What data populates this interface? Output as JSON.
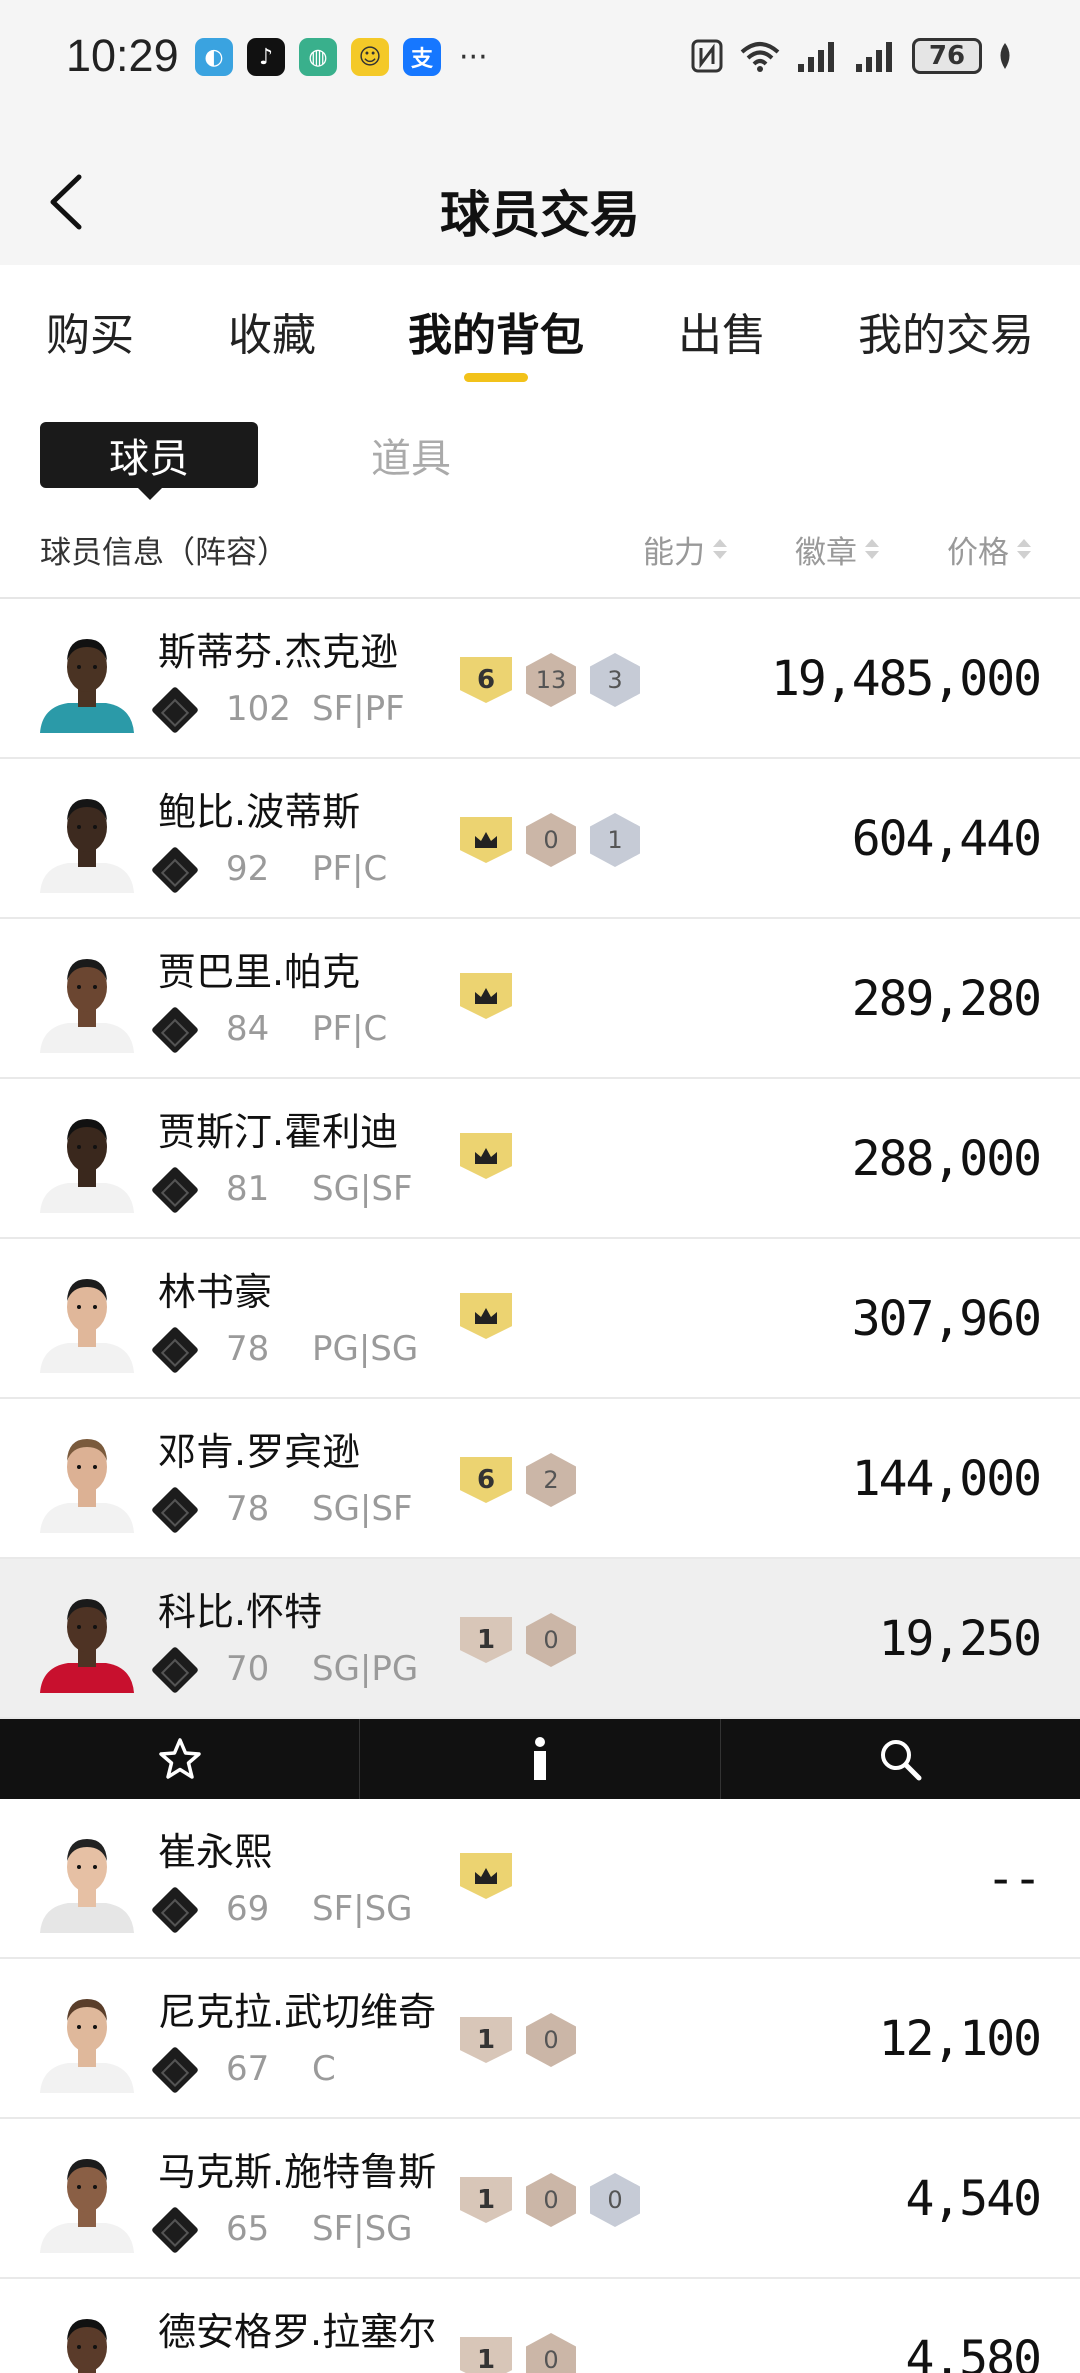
{
  "status_bar": {
    "time": "10:29",
    "battery": "76",
    "more": "···"
  },
  "nav": {
    "title": "球员交易"
  },
  "tabs": [
    {
      "label": "购买"
    },
    {
      "label": "收藏"
    },
    {
      "label": "我的背包"
    },
    {
      "label": "出售"
    },
    {
      "label": "我的交易"
    }
  ],
  "active_tab": "我的背包",
  "segments": {
    "players": "球员",
    "items": "道具"
  },
  "columns": {
    "info": "球员信息（阵容）",
    "ability": "能力",
    "badges": "徽章",
    "price": "价格"
  },
  "colors": {
    "accent": "#f2c21a",
    "dark": "#111111",
    "muted": "#9a9a9a"
  },
  "players": [
    {
      "name": "斯蒂芬.杰克逊",
      "rating": "102",
      "position": "SF|PF",
      "tier": "6",
      "badge1": "13",
      "badge2": "3",
      "price": "19,485,000"
    },
    {
      "name": "鲍比.波蒂斯",
      "rating": "92",
      "position": "PF|C",
      "tier": "crown",
      "badge1": "0",
      "badge2": "1",
      "price": "604,440"
    },
    {
      "name": "贾巴里.帕克",
      "rating": "84",
      "position": "PF|C",
      "tier": "crown",
      "price": "289,280"
    },
    {
      "name": "贾斯汀.霍利迪",
      "rating": "81",
      "position": "SG|SF",
      "tier": "crown",
      "price": "288,000"
    },
    {
      "name": "林书豪",
      "rating": "78",
      "position": "PG|SG",
      "tier": "crown",
      "price": "307,960"
    },
    {
      "name": "邓肯.罗宾逊",
      "rating": "78",
      "position": "SG|SF",
      "tier": "6",
      "badge1": "2",
      "price": "144,000"
    },
    {
      "name": "科比.怀特",
      "rating": "70",
      "position": "SG|PG",
      "tier": "1",
      "badge1": "0",
      "price": "19,250"
    },
    {
      "name": "崔永熙",
      "rating": "69",
      "position": "SF|SG",
      "tier": "crown",
      "price": "--"
    },
    {
      "name": "尼克拉.武切维奇",
      "rating": "67",
      "position": "C",
      "tier": "1",
      "badge1": "0",
      "price": "12,100"
    },
    {
      "name": "马克斯.施特鲁斯",
      "rating": "65",
      "position": "SF|SG",
      "tier": "1",
      "badge1": "0",
      "badge2": "0",
      "price": "4,540"
    },
    {
      "name": "德安格罗.拉塞尔",
      "rating": "",
      "position": "",
      "tier": "1",
      "badge1": "0",
      "price": "4,580"
    }
  ],
  "action_bar": {
    "icons": [
      "star-icon",
      "info-icon",
      "search-icon"
    ]
  }
}
